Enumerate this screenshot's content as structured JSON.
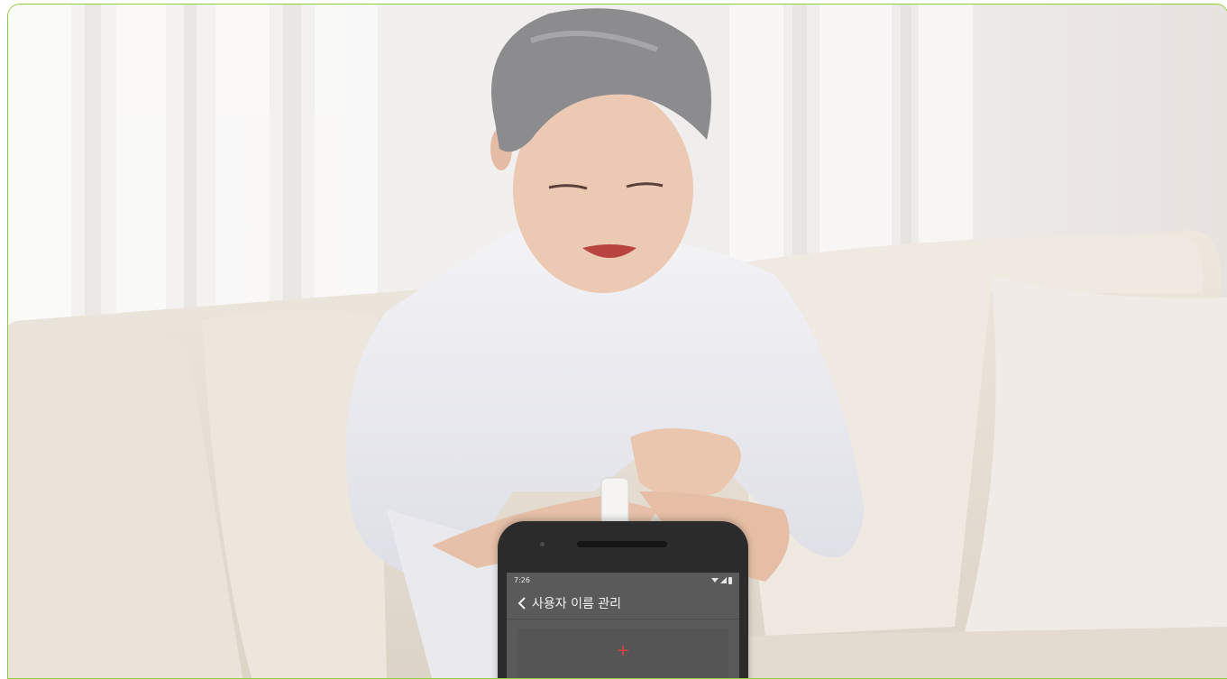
{
  "phone": {
    "status_time": "7:26",
    "title": "사용자 이름 관리",
    "add_label": "+"
  },
  "colors": {
    "frame_border": "#8ccf3c",
    "screen_bg": "#5a5a5a",
    "plus_accent": "#d9453a"
  },
  "icons": [
    "back-chevron-icon",
    "wifi-icon",
    "signal-icon",
    "battery-icon"
  ]
}
